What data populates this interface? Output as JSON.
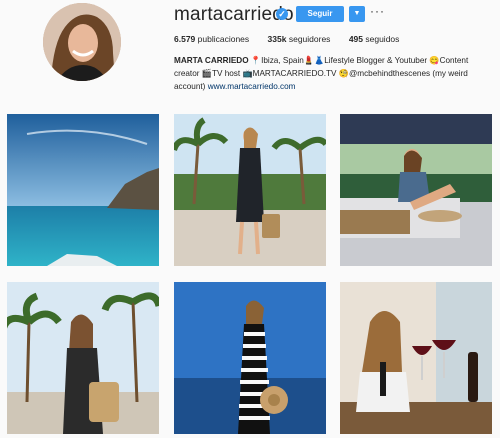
{
  "profile": {
    "username": "martacarriedo",
    "verified_icon": "verified-badge-icon",
    "follow_label": "Seguir",
    "stats": {
      "posts_count": "6.579",
      "posts_label": "publicaciones",
      "followers_count": "335k",
      "followers_label": "seguidores",
      "following_count": "495",
      "following_label": "seguidos"
    },
    "bio": {
      "name": "MARTA CARRIEDO",
      "line1": "📍Ibiza, Spain💄👗Lifestyle Blogger & Youtuber 😋Content",
      "line2": "creator 🎬TV host 📺MARTACARRIEDO.TV 🧐@mcbehindthescenes (my weird",
      "line3": "account)",
      "link": "www.martacarriedo.com"
    }
  },
  "grid": {
    "posts": [
      {
        "name": "post-sea-island"
      },
      {
        "name": "post-palms-dress"
      },
      {
        "name": "post-sofa-hat"
      },
      {
        "name": "post-palms-smile"
      },
      {
        "name": "post-striped-dress"
      },
      {
        "name": "post-wine-glasses"
      }
    ]
  }
}
